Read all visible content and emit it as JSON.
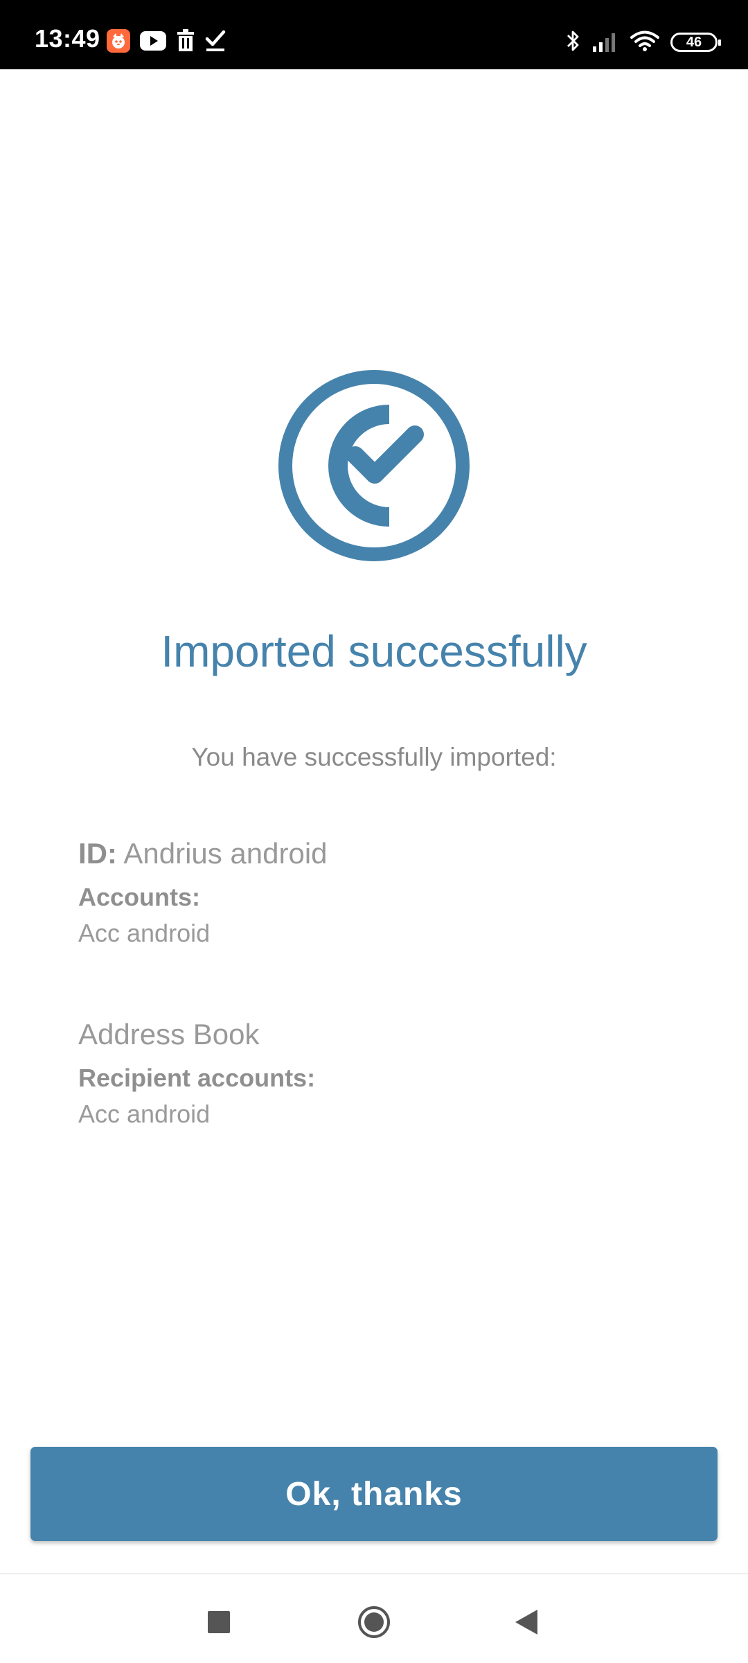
{
  "status_bar": {
    "time": "13:49",
    "battery_level": "46",
    "left_icons": [
      "mi-app-icon",
      "youtube-icon",
      "trash-icon",
      "check-icon"
    ],
    "right_icons": [
      "bluetooth-icon",
      "signal-icon",
      "wifi-icon",
      "battery-icon"
    ]
  },
  "content": {
    "title": "Imported successfully",
    "subtitle": "You have successfully imported:",
    "id_section": {
      "label": "ID:",
      "value": "Andrius android",
      "accounts_label": "Accounts:",
      "accounts_value": "Acc android"
    },
    "address_book_section": {
      "heading": "Address Book",
      "recipient_label": "Recipient accounts:",
      "recipient_value": "Acc android"
    }
  },
  "actions": {
    "ok_label": "Ok, thanks"
  },
  "nav_bar": {
    "buttons": [
      "recents-button",
      "home-button",
      "back-button"
    ]
  },
  "colors": {
    "accent": "#4683ac",
    "text_muted": "#999999",
    "status_bar_bg": "#000000"
  }
}
